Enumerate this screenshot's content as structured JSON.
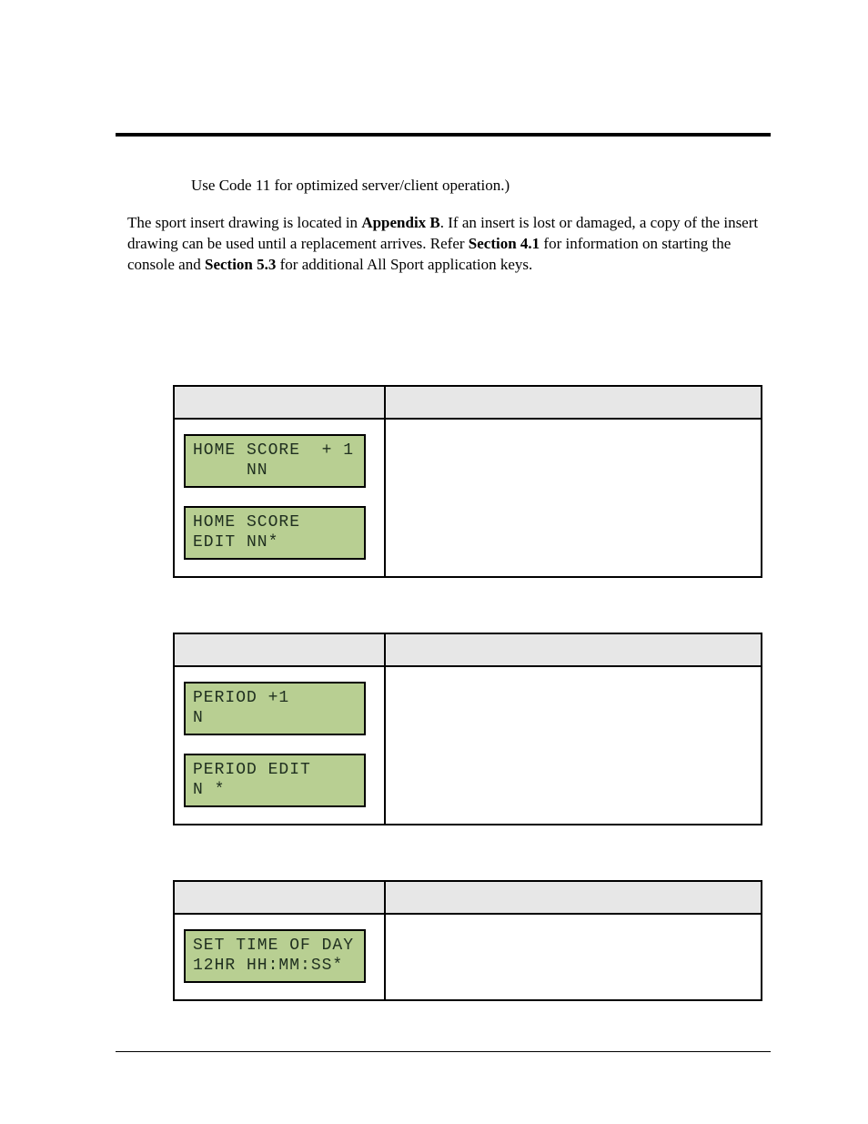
{
  "intro_line": "Use Code 11 for optimized server/client operation.)",
  "para_pre": "The sport insert drawing is located in ",
  "para_b1": "Appendix B",
  "para_mid1": ". If an insert is lost or damaged, a copy of the insert drawing can be used until a replacement arrives. Refer ",
  "para_b2": "Section 4.1",
  "para_mid2": " for information on starting the console and ",
  "para_b3": "Section 5.3",
  "para_end": " for additional All Sport application keys.",
  "tables": [
    {
      "lcds": [
        "HOME SCORE  + 1\n     NN",
        "HOME SCORE\nEDIT NN*"
      ]
    },
    {
      "lcds": [
        "PERIOD +1\nN",
        "PERIOD EDIT\nN *"
      ]
    },
    {
      "lcds": [
        "SET TIME OF DAY\n12HR HH:MM:SS*"
      ]
    }
  ]
}
